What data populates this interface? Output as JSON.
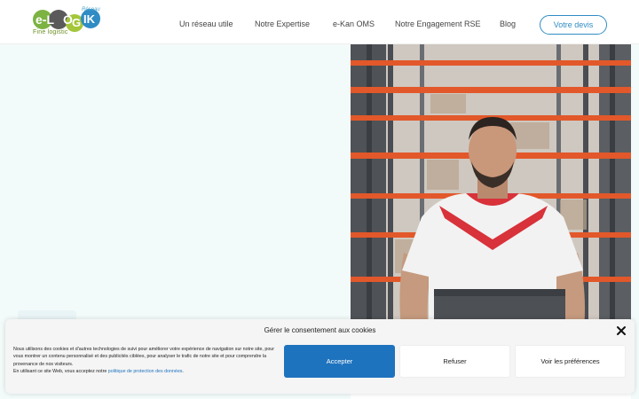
{
  "header": {
    "logo": {
      "text": "e-LOGIK",
      "tagline": "Fine logistic",
      "network": "Réseau"
    },
    "nav": [
      {
        "label": "Un réseau utile"
      },
      {
        "label": "Notre Expertise"
      },
      {
        "label": "e-Kan OMS"
      },
      {
        "label": "Notre Engagement RSE"
      },
      {
        "label": "Blog"
      }
    ],
    "cta_label": "Votre devis"
  },
  "hero": {
    "image": "warehouse-worker-photo"
  },
  "cookie_banner": {
    "title": "Gérer le consentement aux cookies",
    "text_1": "Nous utilisons des cookies et d'autres technologies de suivi pour améliorer votre expérience de navigation sur notre site, pour vous montrer un contenu personnalisé et des publicités ciblées, pour analyser le trafic de notre site et pour comprendre la provenance de nos visiteurs.",
    "text_2_prefix": "En utilisant ce site Web, vous acceptez notre ",
    "text_2_link": "politique de protection des données",
    "text_2_suffix": ".",
    "accept_label": "Accepter",
    "refuse_label": "Refuser",
    "prefs_label": "Voir les préférences"
  },
  "colors": {
    "accent": "#1e73be",
    "cta_border": "#2f8cc4",
    "hero_bg": "#f3fbfa"
  }
}
